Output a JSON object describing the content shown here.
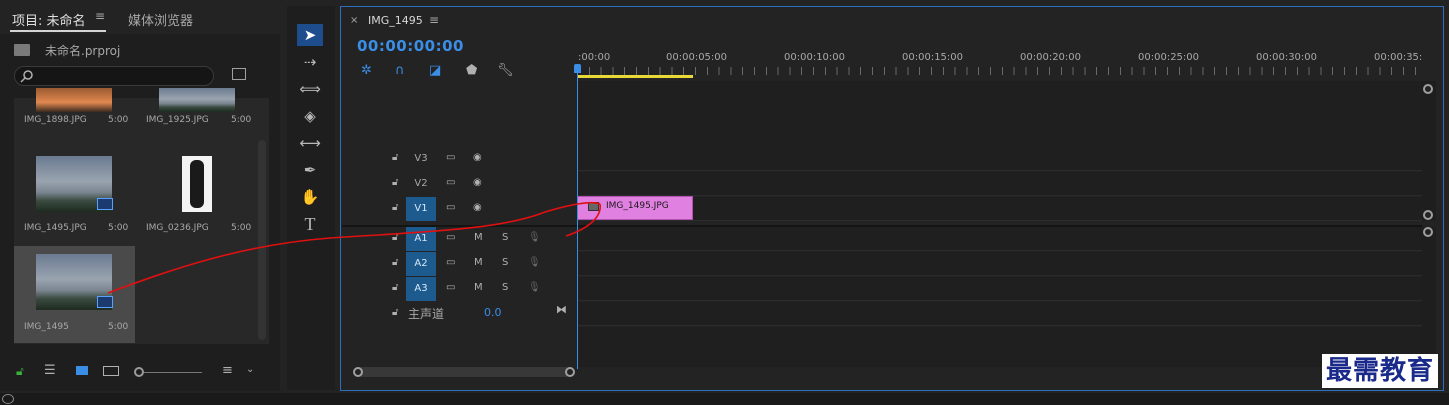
{
  "project": {
    "tab_active": "项目: 未命名",
    "tab_menu": "≡",
    "tab_browser": "媒体浏览器",
    "file_name": "未命名.prproj",
    "search_placeholder": "",
    "items": [
      {
        "name": "IMG_1898.JPG",
        "duration": "5:00"
      },
      {
        "name": "IMG_1925.JPG",
        "duration": "5:00"
      },
      {
        "name": "IMG_1495.JPG",
        "duration": "5:00"
      },
      {
        "name": "IMG_0236.JPG",
        "duration": "5:00"
      },
      {
        "name": "IMG_1495",
        "duration": "5:00"
      }
    ]
  },
  "sequence": {
    "title": "IMG_1495",
    "close": "×",
    "menu": "≡",
    "timecode": "00:00:00:00",
    "ruler": [
      ":00:00",
      "00:00:05:00",
      "00:00:10:00",
      "00:00:15:00",
      "00:00:20:00",
      "00:00:25:00",
      "00:00:30:00",
      "00:00:35:"
    ],
    "video_tracks": [
      {
        "name": "V3"
      },
      {
        "name": "V2"
      },
      {
        "name": "V1"
      }
    ],
    "audio_tracks": [
      {
        "name": "A1",
        "m": "M",
        "s": "S"
      },
      {
        "name": "A2",
        "m": "M",
        "s": "S"
      },
      {
        "name": "A3",
        "m": "M",
        "s": "S"
      }
    ],
    "master_label": "主声道",
    "master_value": "0.0",
    "clip": {
      "name": "IMG_1495.JPG",
      "color": "#e080e0"
    }
  },
  "colors": {
    "accent": "#3a8ee6",
    "work_area": "#e8d838"
  },
  "watermark": "最需教育"
}
